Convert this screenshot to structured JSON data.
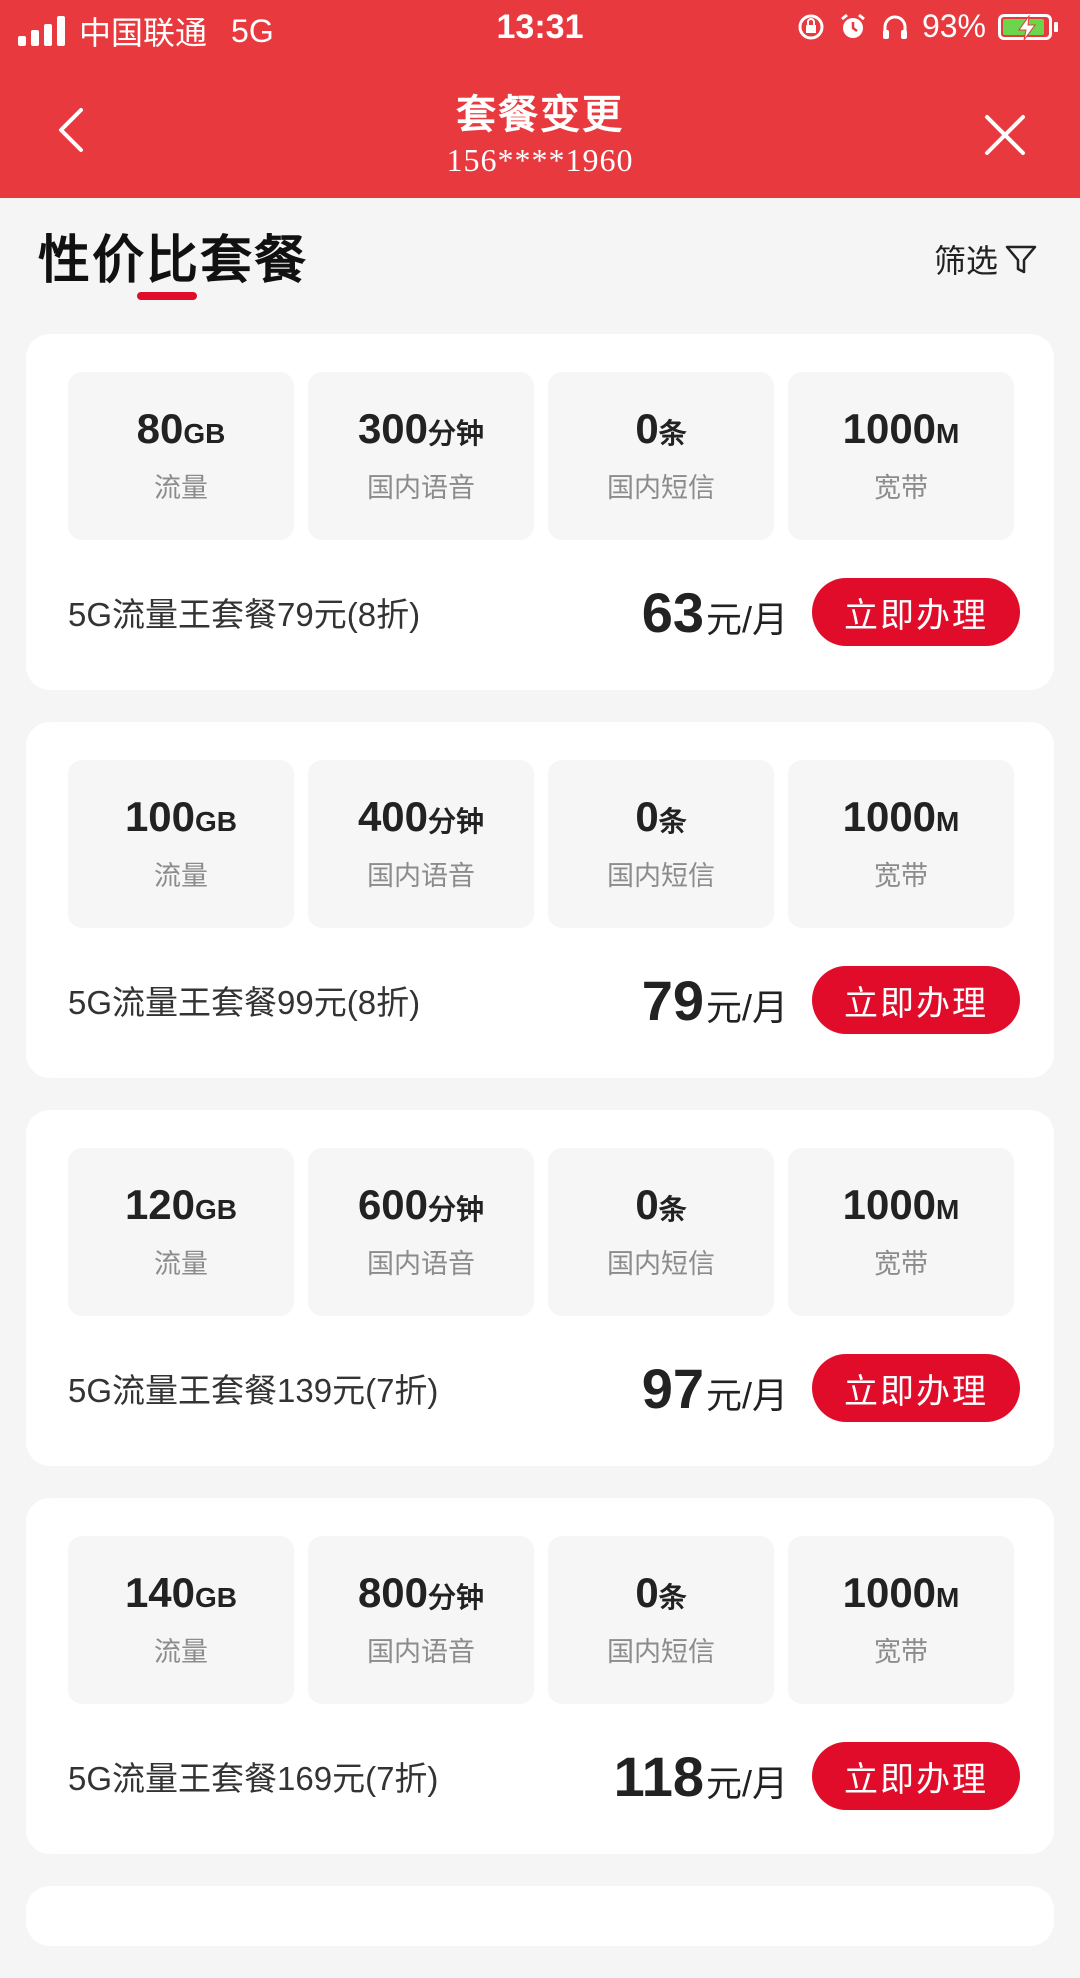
{
  "status_bar": {
    "carrier": "中国联通",
    "network": "5G",
    "time": "13:31",
    "battery": "93%"
  },
  "nav": {
    "title": "套餐变更",
    "phone": "156****1960"
  },
  "section": {
    "title": "性价比套餐",
    "filter_label": "筛选"
  },
  "colors": {
    "header_bg": "#e8393f",
    "accent": "#e00c2a",
    "battery_fill": "#6bd54b"
  },
  "plans": [
    {
      "specs": [
        {
          "value": "80",
          "unit": "GB",
          "label": "流量"
        },
        {
          "value": "300",
          "unit": "分钟",
          "label": "国内语音"
        },
        {
          "value": "0",
          "unit": "条",
          "label": "国内短信"
        },
        {
          "value": "1000",
          "unit": "M",
          "label": "宽带"
        }
      ],
      "name": "5G流量王套餐79元(8折)",
      "price": "63",
      "price_unit": "元/月",
      "button": "立即办理"
    },
    {
      "specs": [
        {
          "value": "100",
          "unit": "GB",
          "label": "流量"
        },
        {
          "value": "400",
          "unit": "分钟",
          "label": "国内语音"
        },
        {
          "value": "0",
          "unit": "条",
          "label": "国内短信"
        },
        {
          "value": "1000",
          "unit": "M",
          "label": "宽带"
        }
      ],
      "name": "5G流量王套餐99元(8折)",
      "price": "79",
      "price_unit": "元/月",
      "button": "立即办理"
    },
    {
      "specs": [
        {
          "value": "120",
          "unit": "GB",
          "label": "流量"
        },
        {
          "value": "600",
          "unit": "分钟",
          "label": "国内语音"
        },
        {
          "value": "0",
          "unit": "条",
          "label": "国内短信"
        },
        {
          "value": "1000",
          "unit": "M",
          "label": "宽带"
        }
      ],
      "name": "5G流量王套餐139元(7折)",
      "price": "97",
      "price_unit": "元/月",
      "button": "立即办理"
    },
    {
      "specs": [
        {
          "value": "140",
          "unit": "GB",
          "label": "流量"
        },
        {
          "value": "800",
          "unit": "分钟",
          "label": "国内语音"
        },
        {
          "value": "0",
          "unit": "条",
          "label": "国内短信"
        },
        {
          "value": "1000",
          "unit": "M",
          "label": "宽带"
        }
      ],
      "name": "5G流量王套餐169元(7折)",
      "price": "118",
      "price_unit": "元/月",
      "button": "立即办理"
    }
  ]
}
